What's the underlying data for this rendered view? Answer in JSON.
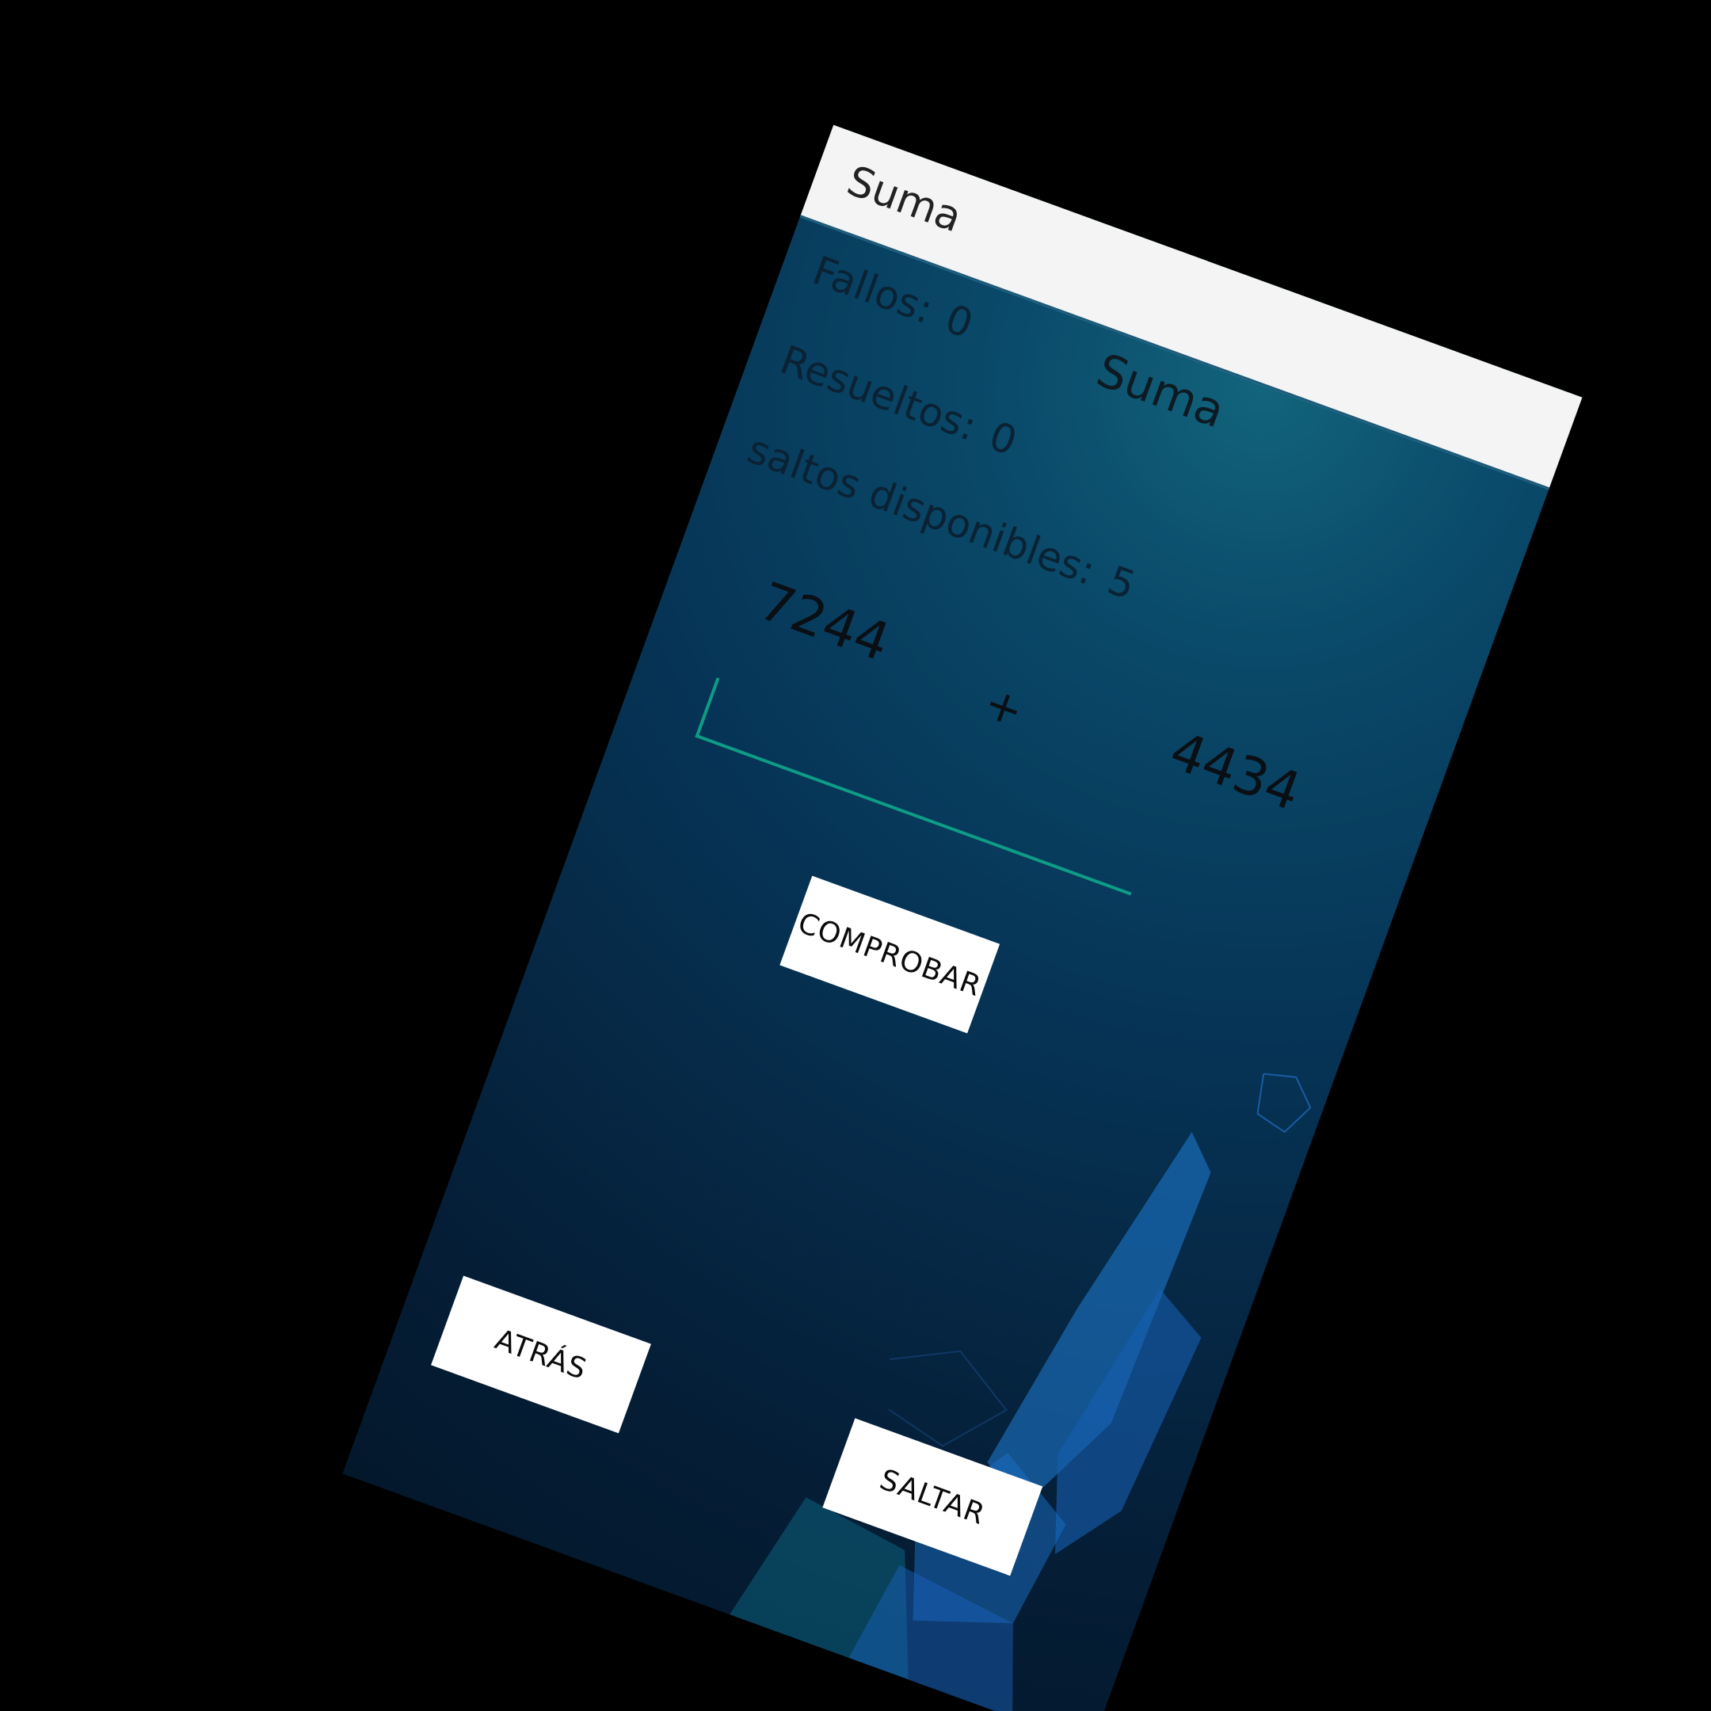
{
  "app_bar": {
    "title": "Suma"
  },
  "screen": {
    "title": "Suma",
    "stats": {
      "fallos_label": "Fallos:",
      "fallos_value": "0",
      "resueltos_label": "Resueltos:",
      "resueltos_value": "0",
      "saltos_label": "saltos disponibles:",
      "saltos_value": "5"
    },
    "problem": {
      "operand1": "7244",
      "operator": "+",
      "operand2": "4434"
    },
    "answer_input": {
      "value": ""
    },
    "buttons": {
      "check": "COMPROBAR",
      "back": "ATRÁS",
      "skip": "SALTAR"
    }
  },
  "colors": {
    "accent": "#0e9c86",
    "app_bar_bg": "#f4f4f4",
    "button_bg": "#ffffff",
    "bg_dark": "#04182c",
    "bg_light": "#12647c"
  }
}
